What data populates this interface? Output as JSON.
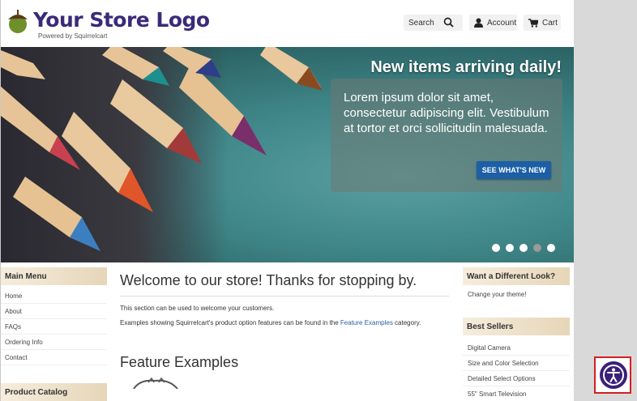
{
  "header": {
    "logo_title": "Your Store Logo",
    "logo_subtitle": "Powered by Squirrelcart",
    "search_placeholder": "Search",
    "account_label": "Account",
    "cart_label": "Cart"
  },
  "hero": {
    "title": "New items arriving daily!",
    "text": "Lorem ipsum dolor sit amet, consectetur adipiscing elit. Vestibulum at tortor et orci sollicitudin malesuada.",
    "cta_label": "SEE WHAT'S NEW",
    "slides": 5,
    "active_slide": 4
  },
  "left": {
    "main_menu_title": "Main Menu",
    "items": [
      "Home",
      "About",
      "FAQs",
      "Ordering Info",
      "Contact"
    ],
    "catalog_title": "Product Catalog"
  },
  "main": {
    "welcome_title": "Welcome to our store! Thanks for stopping by.",
    "para1": "This section can be used to welcome your customers.",
    "para2_before": "Examples showing Squirrelcart's product option features can be found in the ",
    "para2_link": "Feature Examples",
    "para2_after": " category.",
    "feature_title": "Feature Examples"
  },
  "right": {
    "look_title": "Want a Different Look?",
    "look_link": "Change your theme!",
    "best_sellers_title": "Best Sellers",
    "best_sellers": [
      "Digital Camera",
      "Size and Color Selection",
      "Detailed Select Options",
      "55\" Smart Television"
    ]
  },
  "colors": {
    "logo": "#3b2a7a",
    "cta": "#1c5fa6",
    "accessibility": "#3a1f7a",
    "highlight_frame": "#d42020"
  }
}
